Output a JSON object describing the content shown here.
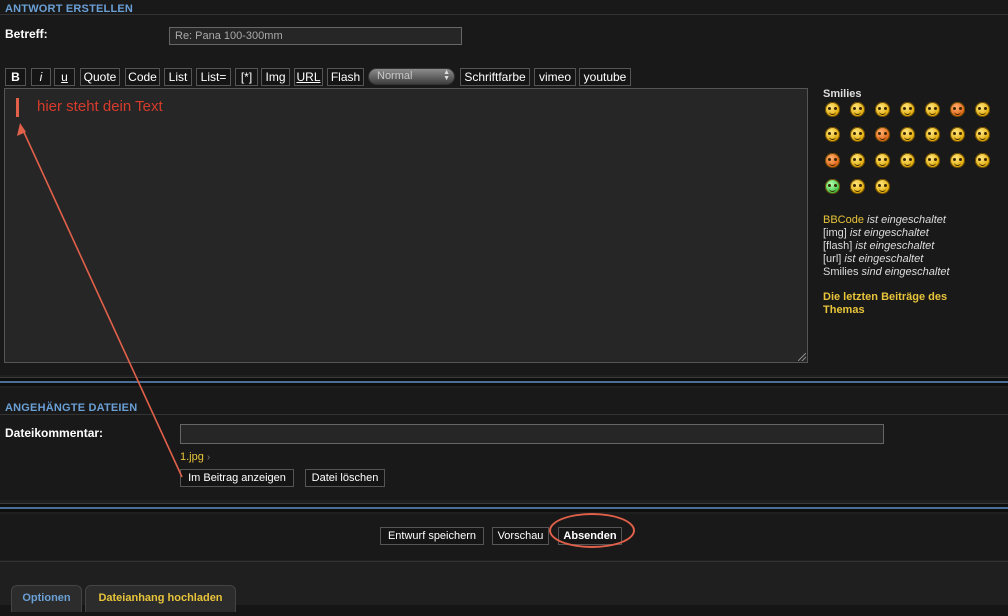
{
  "reply": {
    "section_title": "ANTWORT ERSTELLEN",
    "subject_label": "Betreff:",
    "subject_value": "Re: Pana 100-300mm"
  },
  "toolbar": {
    "bold": "B",
    "italic": "i",
    "underline": "u",
    "quote": "Quote",
    "code": "Code",
    "list": "List",
    "list_eq": "List=",
    "list_item": "[*]",
    "img": "Img",
    "url": "URL",
    "flash": "Flash",
    "font_size_selected": "Normal",
    "font_color": "Schriftfarbe",
    "vimeo": "vimeo",
    "youtube": "youtube"
  },
  "editor": {
    "annotation_text": "hier steht dein Text",
    "annotation_color": "#d63b2b"
  },
  "smilies": {
    "title": "Smilies",
    "count": 24
  },
  "status": {
    "bbcode_label": "BBCode",
    "bbcode_state": "ist eingeschaltet",
    "img_label": "[img]",
    "img_state": "ist eingeschaltet",
    "flash_label": "[flash]",
    "flash_state": "ist eingeschaltet",
    "url_label": "[url]",
    "url_state": "ist eingeschaltet",
    "smilies_label": "Smilies",
    "smilies_state": "sind eingeschaltet",
    "latest_posts_link": "Die letzten Beiträge des Themas"
  },
  "attachments": {
    "section_title": "ANGEHÄNGTE DATEIEN",
    "comment_label": "Dateikommentar:",
    "comment_value": "",
    "file_name": "1.jpg",
    "show_in_post": "Im Beitrag anzeigen",
    "delete_file": "Datei löschen"
  },
  "actions": {
    "save_draft": "Entwurf speichern",
    "preview": "Vorschau",
    "submit": "Absenden"
  },
  "tabs": [
    {
      "label": "Optionen"
    },
    {
      "label": "Dateianhang hochladen"
    }
  ],
  "colors": {
    "accent_blue": "#6aa0d6",
    "highlight_yellow": "#e8c43a",
    "annotation_red": "#e0604a"
  }
}
